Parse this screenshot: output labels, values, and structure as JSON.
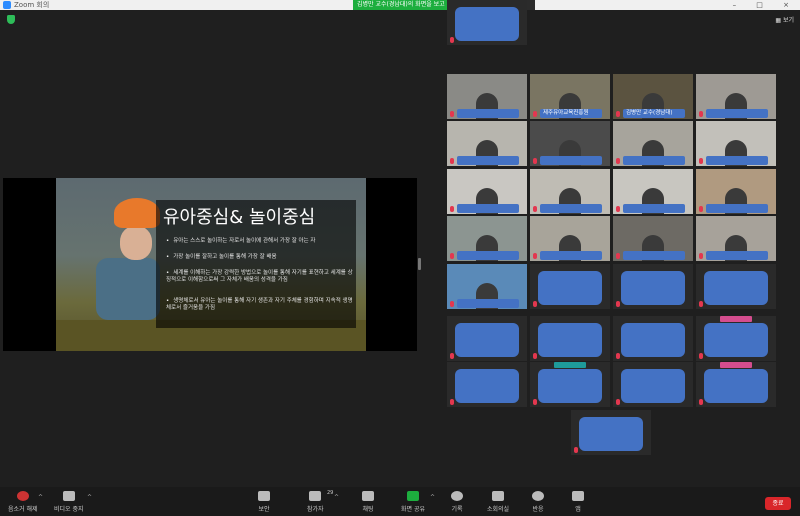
{
  "window": {
    "title": "Zoom 회의",
    "controls": "– □ ×"
  },
  "share_banner": {
    "text": "김병만 교수(경남대)의 화면을 보고 있습니다",
    "view_options": "옵션 보기 ⌄"
  },
  "top_right": {
    "view_label": "보기"
  },
  "slide": {
    "title": "유아중심& 놀이중심",
    "bullets": [
      "유아는 스스로 놀이하는 자로서 놀이에 관해서 가장 잘 아는 자",
      "가장 놀이를 잘하고 놀이를 통해 가장 잘 배움",
      "세계를 이해하는 가장 강력한 방법으로 놀이를 통해 자기를 표현하고 세계를 상징적으로 이해함으로써 그 자체가 배움의 성격을 가짐",
      "생명체로서 유아는 놀이를 통해 자기 생존과 자기 주체를 경험하며 지속적 생명체로서 즐거움을 가짐"
    ]
  },
  "gallery": {
    "tiles": [
      {
        "name": "",
        "kind": "video",
        "bg": "#8a8a86",
        "active": false
      },
      {
        "name": "제주유아교육진흥원",
        "kind": "video",
        "bg": "#7a7562",
        "active": false
      },
      {
        "name": "김병만 교수(경남대)",
        "kind": "video",
        "bg": "#5b5340",
        "active": true
      },
      {
        "name": "",
        "kind": "video",
        "bg": "#9e9a94",
        "active": false
      },
      {
        "name": "",
        "kind": "video",
        "bg": "#b7b5ae",
        "active": false
      },
      {
        "name": "",
        "kind": "video",
        "bg": "#4b4b4b",
        "active": false
      },
      {
        "name": "",
        "kind": "video",
        "bg": "#a7a49c",
        "active": false
      },
      {
        "name": "",
        "kind": "video",
        "bg": "#c2c0ba",
        "active": false
      },
      {
        "name": "",
        "kind": "video",
        "bg": "#c9c7c2",
        "active": false
      },
      {
        "name": "",
        "kind": "video",
        "bg": "#bfbcb4",
        "active": false
      },
      {
        "name": "",
        "kind": "video",
        "bg": "#c8c6c0",
        "active": false
      },
      {
        "name": "",
        "kind": "video",
        "bg": "#b09a80",
        "active": false
      },
      {
        "name": "",
        "kind": "video",
        "bg": "#8c9591",
        "active": false
      },
      {
        "name": "",
        "kind": "video",
        "bg": "#a8a49a",
        "active": false
      },
      {
        "name": "",
        "kind": "video",
        "bg": "#6d6a64",
        "active": false
      },
      {
        "name": "",
        "kind": "video",
        "bg": "#a7a29a",
        "active": false
      },
      {
        "name": "",
        "kind": "video",
        "bg": "#5a8ab8",
        "active": false
      },
      {
        "name": "",
        "kind": "off",
        "bar": "",
        "active": false
      },
      {
        "name": "",
        "kind": "off",
        "bar": "",
        "active": false
      },
      {
        "name": "",
        "kind": "off",
        "bar": "",
        "active": false
      },
      {
        "name": "",
        "kind": "off",
        "bar": "",
        "active": false
      },
      {
        "name": "",
        "kind": "off",
        "bar": "",
        "active": false
      },
      {
        "name": "",
        "kind": "off",
        "bar": "",
        "active": false
      },
      {
        "name": "",
        "kind": "off",
        "bar": "#d44d8e",
        "active": false
      },
      {
        "name": "",
        "kind": "off",
        "bar": "",
        "active": false
      },
      {
        "name": "",
        "kind": "off",
        "bar": "#1e9b9a",
        "active": false
      },
      {
        "name": "",
        "kind": "off",
        "bar": "",
        "active": false
      },
      {
        "name": "",
        "kind": "off",
        "bar": "#d44d8e",
        "active": false
      },
      {
        "name": "",
        "kind": "off",
        "bar": "",
        "active": false
      }
    ]
  },
  "toolbar": {
    "mute_label": "음소거 해제",
    "video_label": "비디오 중지",
    "security_label": "보안",
    "participants_label": "참가자",
    "participants_count": "29",
    "chat_label": "채팅",
    "share_label": "화면 공유",
    "record_label": "기록",
    "breakout_label": "소회의실",
    "reactions_label": "반응",
    "apps_label": "앱",
    "end_label": "종료"
  },
  "icons": {
    "mute": "mic-muted-icon",
    "video": "camera-icon",
    "security": "shield-icon",
    "participants": "people-icon",
    "chat": "chat-bubble-icon",
    "share": "share-screen-icon",
    "record": "record-icon",
    "breakout": "grid-icon",
    "reactions": "smile-icon",
    "apps": "apps-icon"
  }
}
